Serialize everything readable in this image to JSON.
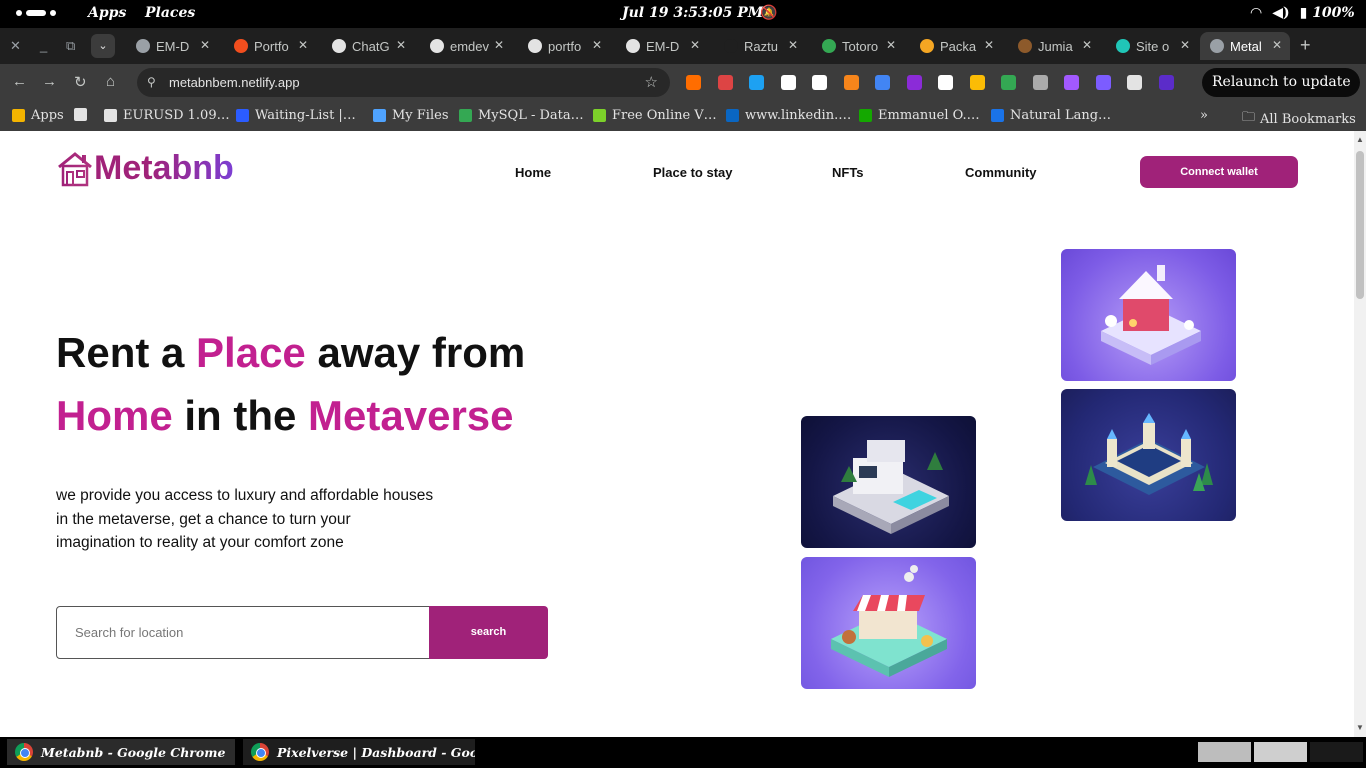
{
  "system_bar": {
    "apps": "Apps",
    "places": "Places",
    "clock": "Jul 19   3:53:05 PM",
    "battery": "100%"
  },
  "tabs": [
    {
      "title": "EM-D",
      "icon": "globe-icon",
      "color": "#9aa0a6"
    },
    {
      "title": "Portfo",
      "icon": "figma-icon",
      "color": "#f24e1e"
    },
    {
      "title": "ChatG",
      "icon": "openai-icon",
      "color": "#e3e3e3"
    },
    {
      "title": "emdev",
      "icon": "github-icon",
      "color": "#e3e3e3"
    },
    {
      "title": "portfo",
      "icon": "vercel-icon",
      "color": "#e3e3e3"
    },
    {
      "title": "EM-D",
      "icon": "vercel-icon",
      "color": "#e3e3e3"
    },
    {
      "title": "Raztu",
      "icon": "blank-icon",
      "color": "#1f1f1f"
    },
    {
      "title": "Totoro",
      "icon": "maps-pin-icon",
      "color": "#34a853"
    },
    {
      "title": "Packa",
      "icon": "star-badge-icon",
      "color": "#f5a623"
    },
    {
      "title": "Jumia",
      "icon": "jumia-icon",
      "color": "#8d5a2b"
    },
    {
      "title": "Site o",
      "icon": "netlify-icon",
      "color": "#20c6b7"
    },
    {
      "title": "Metal",
      "icon": "globe-icon",
      "color": "#9aa0a6",
      "active": true
    }
  ],
  "toolbar": {
    "url": "metabnbem.netlify.app",
    "relaunch": "Relaunch to update",
    "extension_colors": [
      "#ff6d00",
      "#d44",
      "#1da1f2",
      "#fff",
      "#fff",
      "#f6851b",
      "#4285f4",
      "#8b2bd8",
      "#fff",
      "#fbbc05",
      "#34a853",
      "#aaa",
      "#a259ff",
      "#7c5cff",
      "#e3e3e3",
      "#5b2cc9"
    ]
  },
  "bookmarks": [
    {
      "label": "Apps",
      "icon": "apps-grid-icon",
      "color": "#f4b400"
    },
    {
      "label": "",
      "icon": "github-icon",
      "color": "#e3e3e3"
    },
    {
      "label": "EURUSD 1.09…",
      "icon": "tradingview-icon",
      "color": "#e3e3e3"
    },
    {
      "label": "Waiting-List |…",
      "icon": "b-logo-icon",
      "color": "#2b5cff"
    },
    {
      "label": "My Files",
      "icon": "files-icon",
      "color": "#4fa3ff"
    },
    {
      "label": "MySQL - Data…",
      "icon": "mysql-icon",
      "color": "#34a853"
    },
    {
      "label": "Free Online V…",
      "icon": "download-arrow-icon",
      "color": "#7cd12a"
    },
    {
      "label": "www.linkedin.…",
      "icon": "linkedin-icon",
      "color": "#0a66c2"
    },
    {
      "label": "Emmanuel O.…",
      "icon": "upwork-icon",
      "color": "#14a800"
    },
    {
      "label": "Natural Lang…",
      "icon": "c-logo-icon",
      "color": "#1a73e8"
    }
  ],
  "all_bookmarks": "All Bookmarks",
  "site": {
    "logo": "Metabnb",
    "nav": [
      "Home",
      "Place to stay",
      "NFTs",
      "Community"
    ],
    "connect": "Connect wallet",
    "hero": {
      "line1": {
        "a": "Rent a ",
        "b": "Place",
        "c": " away from"
      },
      "line2": {
        "a": "Home",
        "b": " in the ",
        "c": "Metaverse"
      }
    },
    "desc": {
      "l1": "we provide you access to luxury and affordable houses",
      "l2": "in the metaverse, get a chance to turn your",
      "l3": "imagination to reality at your comfort zone"
    },
    "search_placeholder": "Search for location",
    "search_button": "search"
  },
  "taskbar": {
    "task1": "Metabnb - Google Chrome",
    "task2": "Pixelverse | Dashboard - Goo…"
  }
}
